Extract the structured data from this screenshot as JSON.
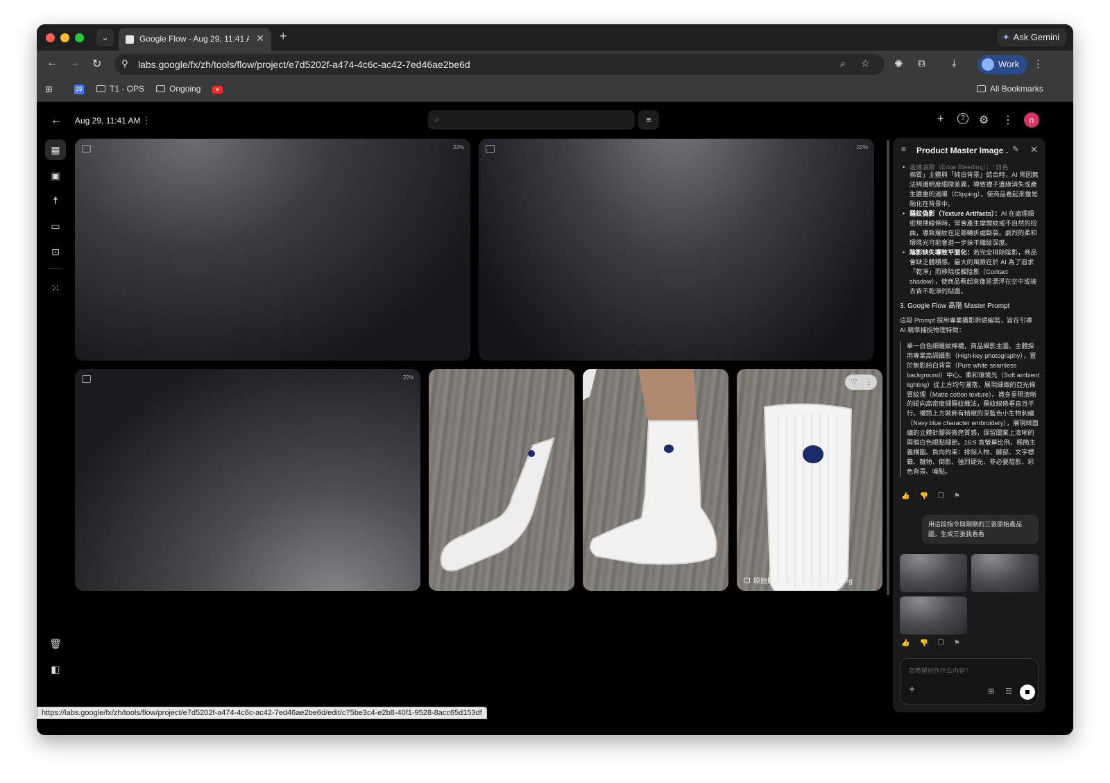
{
  "browser": {
    "tab_title": "Google Flow - Aug 29, 11:41 A",
    "tab_close": "✕",
    "new_tab": "+",
    "ask_gemini": "Ask Gemini",
    "url": "labs.google/fx/zh/tools/flow/project/e7d5202f-a474-4c6c-ac42-7ed46ae2be6d",
    "profile": "Work",
    "bookmarks": {
      "calendar": "29",
      "folder1": "T1 - OPS",
      "folder2": "Ongoing",
      "all": "All Bookmarks"
    },
    "status_url": "https://labs.google/fx/zh/tools/flow/project/e7d5202f-a474-4c6c-ac42-7ed46ae2be6d/edit/c75be3c4-e2b8-40f1-9528-8acc65d153df"
  },
  "app": {
    "project_date": "Aug 29, 11:41 AM",
    "user_initial": "n",
    "tiles": [
      {
        "type": "placeholder",
        "progress": "22%"
      },
      {
        "type": "placeholder",
        "progress": "22%"
      },
      {
        "type": "placeholder",
        "progress": "22%"
      },
      {
        "type": "photo"
      },
      {
        "type": "photo"
      },
      {
        "type": "photo",
        "filename": "原始照片_襪子_商品細節圖.jpeg"
      }
    ]
  },
  "panel": {
    "title": "Product Master Image ...",
    "faded_line": "邊緣溢散（Edge Bleeding）：「白色",
    "intro_text": "棉質」主體與「純白背景」結合時，AI 常因無法辨識明度細微差異，導致襪子邊緣消失或產生嚴重的過曝（Clipping），使商品看起來像是融化在背景中。",
    "bullets": [
      {
        "label": "羅紋偽影（Texture Artifacts）：",
        "text": "AI 在處理細密規律線條時，常會產生摩爾紋或不自然的扭曲，導致羅紋在足跟轉折處斷裂。劇烈的柔和環境光可能會進一步抹平織紋深度。"
      },
      {
        "label": "陰影缺失導致平面化：",
        "text": "若完全排除陰影，商品會缺乏體積感。最大的風險在於 AI 為了追求「乾淨」而移除接觸陰影（Contact shadow），使商品看起來像是漂浮在空中或被去背不乾淨的貼圖。"
      }
    ],
    "section_heading": "3. Google Flow 高階 Master Prompt",
    "section_intro": "這段 Prompt 採用專業攝影術語編寫，旨在引導 AI 精準捕捉物理特徵：",
    "prompt_text": "單一白色細羅紋棉襪，商品攝影主圖。主體採用專業高調攝影（High-key photography），置於無影純白背景（Pure white seamless background）中心。柔和環境光（Soft ambient lighting）從上方均勻灑落，展現細緻的亞光棉質紋理（Matte cotton texture）。襪身呈現清晰的縱向高密度細羅紋織法，羅紋線條垂直且平行。襪筒上方裝飾有精緻的深藍色小生物刺繡（Navy blue character embroidery），展現絨面繡的立體針腳與微亮質感，保留圖案上清晰的兩個白色眼點細節。16:9 寬螢幕比例，極簡主義構圖。負向約束：排除人物、腳部、文字標籤、雜物、倒影、強烈硬光、非必要陰影、彩色背景、噪點。",
    "user_message": "用這段指令與剛剛的三張原始產品圖，生成三張我看看",
    "composer_placeholder": "您希望创作什么内容?"
  },
  "icons": {
    "back": "←",
    "forward": "→",
    "reload": "↻",
    "menu": "⋮",
    "add": "+",
    "help": "?",
    "settings": "⚙",
    "search": "⌕",
    "filter": "≡",
    "heart": "♡"
  }
}
